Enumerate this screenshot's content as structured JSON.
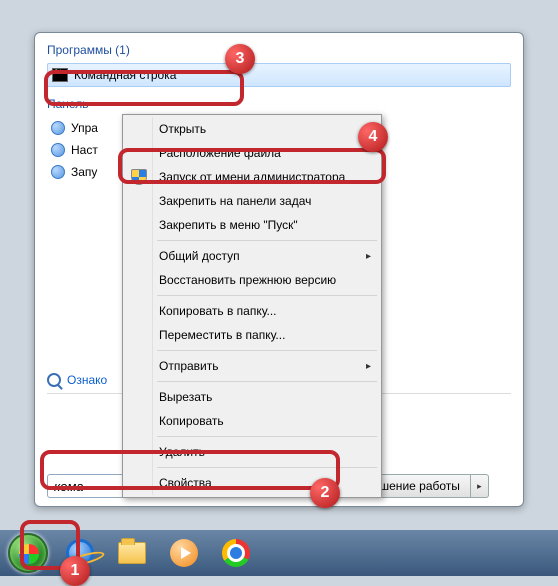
{
  "groups": {
    "programs_title": "Программы (1)",
    "panel_title": "Панель"
  },
  "result": {
    "cmd_label": "Командная строка"
  },
  "panel_items": [
    "Упра",
    "Наст",
    "Запу"
  ],
  "see_more": "Ознако",
  "search": {
    "value": "кома",
    "clear": "×"
  },
  "shutdown": {
    "label": "Завершение работы",
    "arrow": "▸"
  },
  "context_menu": {
    "open": "Открыть",
    "open_location": "Расположение файла",
    "run_as_admin": "Запуск от имени администратора",
    "pin_taskbar": "Закрепить на панели задач",
    "pin_start": "Закрепить в меню \"Пуск\"",
    "share": "Общий доступ",
    "restore_prev": "Восстановить прежнюю версию",
    "copy_to_folder": "Копировать в папку...",
    "move_to_folder": "Переместить в папку...",
    "send_to": "Отправить",
    "cut": "Вырезать",
    "copy": "Копировать",
    "delete": "Удалить",
    "properties": "Свойства",
    "arrow": "▸"
  },
  "badges": {
    "b1": "1",
    "b2": "2",
    "b3": "3",
    "b4": "4"
  }
}
